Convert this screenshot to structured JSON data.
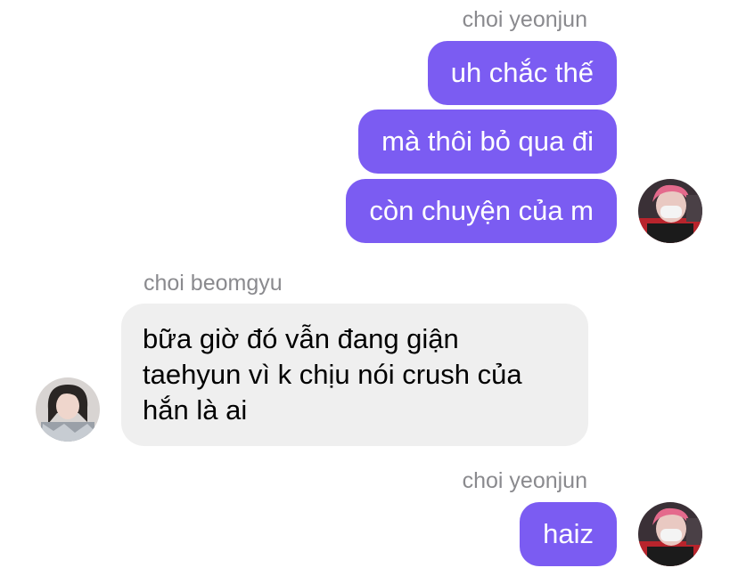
{
  "colors": {
    "outgoing_bubble": "#7b5cf2",
    "incoming_bubble": "#efefef",
    "sender_name": "#8a8a8e"
  },
  "messages": [
    {
      "sender": "choi yeonjun",
      "direction": "outgoing",
      "bubbles": [
        "uh chắc thế",
        "mà thôi bỏ qua đi",
        "còn chuyện của m"
      ],
      "avatar": "avatar-yeonjun"
    },
    {
      "sender": "choi beomgyu",
      "direction": "incoming",
      "bubbles": [
        {
          "lines": [
            "bữa giờ đó vẫn đang giận",
            "taehyun vì k chịu nói crush của",
            "hắn là ai"
          ]
        }
      ],
      "avatar": "avatar-beomgyu"
    },
    {
      "sender": "choi yeonjun",
      "direction": "outgoing",
      "bubbles": [
        "haiz"
      ],
      "avatar": "avatar-yeonjun"
    }
  ]
}
